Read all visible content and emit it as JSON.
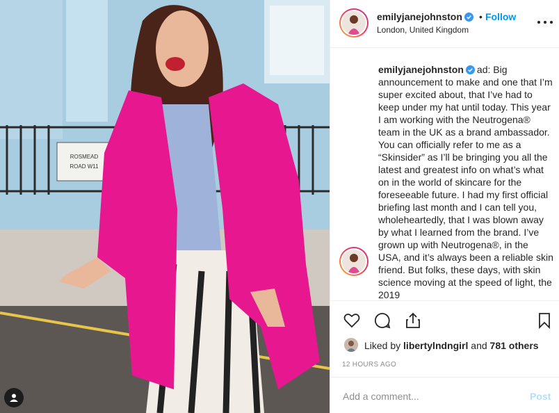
{
  "post": {
    "username": "emilyjanejohnston",
    "verified": true,
    "separator": "•",
    "follow_label": "Follow",
    "location": "London, United Kingdom",
    "more_icon": "ellipsis-horizontal-icon",
    "caption_username": "emilyjanejohnston",
    "caption_text": "ad: Big announcement to make and one that I’m super excited about, that I’ve had to keep under my hat until today. This year I am working with the Neutrogena® team in the UK as a brand ambassador. You can officially refer to me as a “Skinsider” as I’ll be bringing you all the latest and greatest info on what’s what on in the world of skincare for the foreseeable future. I had my first official briefing last month and I can tell you, wholeheartedly, that I was blown away by what I learned from the brand. I’ve grown up with Neutrogena®, in the USA, and it’s always been a reliable skin friend. But folks, these days, with skin science moving at the speed of light, the 2019",
    "photo_street_sign": "ROSMEAD ROAD W11"
  },
  "actions": {
    "like_icon": "heart-icon",
    "comment_icon": "comment-bubble-icon",
    "share_icon": "share-icon",
    "save_icon": "bookmark-icon"
  },
  "likes": {
    "prefix": "Liked by",
    "user": "libertylndngirl",
    "conjunction": "and",
    "count": "781 others"
  },
  "timestamp": "12 HOURS AGO",
  "comment_box": {
    "placeholder": "Add a comment...",
    "post_label": "Post"
  },
  "colors": {
    "link_blue": "#0095f6",
    "post_disabled": "#b2dffc",
    "coat_pink": "#e6178f",
    "wall_blue": "#9fc3d8"
  }
}
